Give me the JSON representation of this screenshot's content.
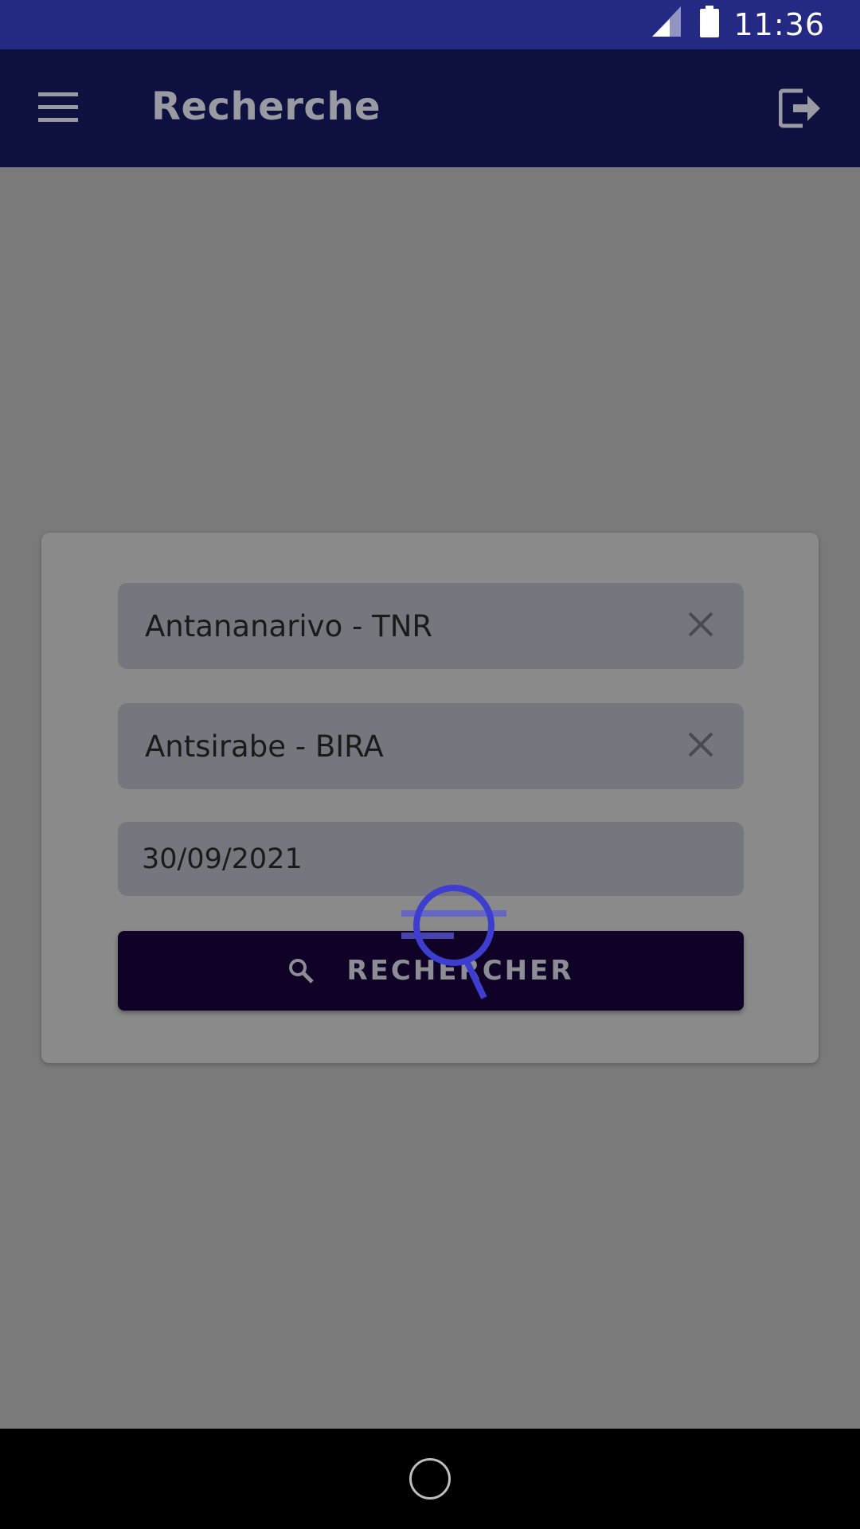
{
  "status_bar": {
    "time": "11:36",
    "icons": [
      "signal-icon",
      "battery-icon"
    ]
  },
  "app_bar": {
    "title": "Recherche",
    "menu_icon": "hamburger-menu-icon",
    "logout_icon": "logout-icon"
  },
  "form": {
    "origin": {
      "value": "Antananarivo - TNR",
      "clear_icon": "close-icon"
    },
    "destination": {
      "value": "Antsirabe - BIRA",
      "clear_icon": "close-icon"
    },
    "date": {
      "value": "30/09/2021"
    },
    "search_button": {
      "label": "RECHERCHER",
      "icon": "search-icon"
    }
  },
  "loader": {
    "icon": "searching-magnifier-icon",
    "color": "#3d3dd0"
  },
  "colors": {
    "status_bar": "#242a84",
    "app_bar": "#0e1040",
    "button": "#100226",
    "overlay": "#7a7a7a"
  },
  "nav_bar": {
    "home_icon": "home-circle-icon"
  }
}
